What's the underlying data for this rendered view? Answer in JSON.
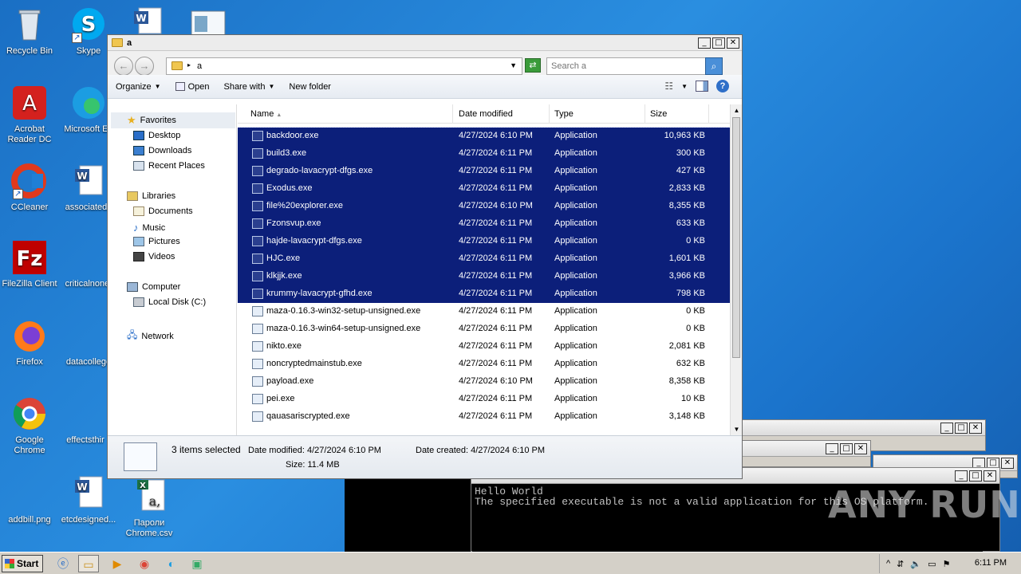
{
  "desktop": {
    "icons": [
      {
        "label": "Recycle Bin"
      },
      {
        "label": "Skype"
      },
      {
        "label": "Acrobat Reader DC"
      },
      {
        "label": "Microsoft Ed"
      },
      {
        "label": "CCleaner"
      },
      {
        "label": "associateda"
      },
      {
        "label": "FileZilla Client"
      },
      {
        "label": "criticalnone."
      },
      {
        "label": "Firefox"
      },
      {
        "label": "datacollege"
      },
      {
        "label": "Google Chrome"
      },
      {
        "label": "effectsthir"
      },
      {
        "label": "addbill.png"
      },
      {
        "label": "etcdesigned..."
      },
      {
        "label": "Пароли Chrome.csv"
      }
    ]
  },
  "explorer": {
    "title": "a",
    "address": "a",
    "search_placeholder": "Search a",
    "toolbar": {
      "organize": "Organize",
      "open": "Open",
      "share_with": "Share with",
      "new_folder": "New folder"
    },
    "nav": {
      "favorites": "Favorites",
      "desktop": "Desktop",
      "downloads": "Downloads",
      "recent_places": "Recent Places",
      "libraries": "Libraries",
      "documents": "Documents",
      "music": "Music",
      "pictures": "Pictures",
      "videos": "Videos",
      "computer": "Computer",
      "local_disk": "Local Disk (C:)",
      "network": "Network"
    },
    "columns": {
      "name": "Name",
      "date": "Date modified",
      "type": "Type",
      "size": "Size"
    },
    "files": [
      {
        "name": "backdoor.exe",
        "date": "4/27/2024 6:10 PM",
        "type": "Application",
        "size": "10,963 KB"
      },
      {
        "name": "build3.exe",
        "date": "4/27/2024 6:11 PM",
        "type": "Application",
        "size": "300 KB"
      },
      {
        "name": "degrado-lavacrypt-dfgs.exe",
        "date": "4/27/2024 6:11 PM",
        "type": "Application",
        "size": "427 KB"
      },
      {
        "name": "Exodus.exe",
        "date": "4/27/2024 6:11 PM",
        "type": "Application",
        "size": "2,833 KB"
      },
      {
        "name": "file%20explorer.exe",
        "date": "4/27/2024 6:10 PM",
        "type": "Application",
        "size": "8,355 KB"
      },
      {
        "name": "Fzonsvup.exe",
        "date": "4/27/2024 6:11 PM",
        "type": "Application",
        "size": "633 KB"
      },
      {
        "name": "hajde-lavacrypt-dfgs.exe",
        "date": "4/27/2024 6:11 PM",
        "type": "Application",
        "size": "0 KB"
      },
      {
        "name": "HJC.exe",
        "date": "4/27/2024 6:11 PM",
        "type": "Application",
        "size": "1,601 KB"
      },
      {
        "name": "klkjjk.exe",
        "date": "4/27/2024 6:11 PM",
        "type": "Application",
        "size": "3,966 KB"
      },
      {
        "name": "krummy-lavacrypt-gfhd.exe",
        "date": "4/27/2024 6:11 PM",
        "type": "Application",
        "size": "798 KB"
      },
      {
        "name": "maza-0.16.3-win32-setup-unsigned.exe",
        "date": "4/27/2024 6:11 PM",
        "type": "Application",
        "size": "0 KB"
      },
      {
        "name": "maza-0.16.3-win64-setup-unsigned.exe",
        "date": "4/27/2024 6:11 PM",
        "type": "Application",
        "size": "0 KB"
      },
      {
        "name": "nikto.exe",
        "date": "4/27/2024 6:11 PM",
        "type": "Application",
        "size": "2,081 KB"
      },
      {
        "name": "noncryptedmainstub.exe",
        "date": "4/27/2024 6:11 PM",
        "type": "Application",
        "size": "632 KB"
      },
      {
        "name": "payload.exe",
        "date": "4/27/2024 6:10 PM",
        "type": "Application",
        "size": "8,358 KB"
      },
      {
        "name": "pei.exe",
        "date": "4/27/2024 6:11 PM",
        "type": "Application",
        "size": "10 KB"
      },
      {
        "name": "qauasariscrypted.exe",
        "date": "4/27/2024 6:11 PM",
        "type": "Application",
        "size": "3,148 KB"
      }
    ],
    "selected_count": 10,
    "details": {
      "selection": "3 items selected",
      "date_modified": "Date modified: 4/27/2024 6:10 PM",
      "date_created": "Date created: 4/27/2024 6:10 PM",
      "size": "Size: 11.4 MB"
    }
  },
  "console": {
    "line1": "Hello World",
    "line2": "The specified executable is not a valid application for this OS platform."
  },
  "watermark": "ANY RUN",
  "taskbar": {
    "start_label": "Start",
    "clock": "6:11 PM"
  },
  "colors": {
    "selection": "#0c1f7a",
    "desktop": "#1f7fd6"
  }
}
